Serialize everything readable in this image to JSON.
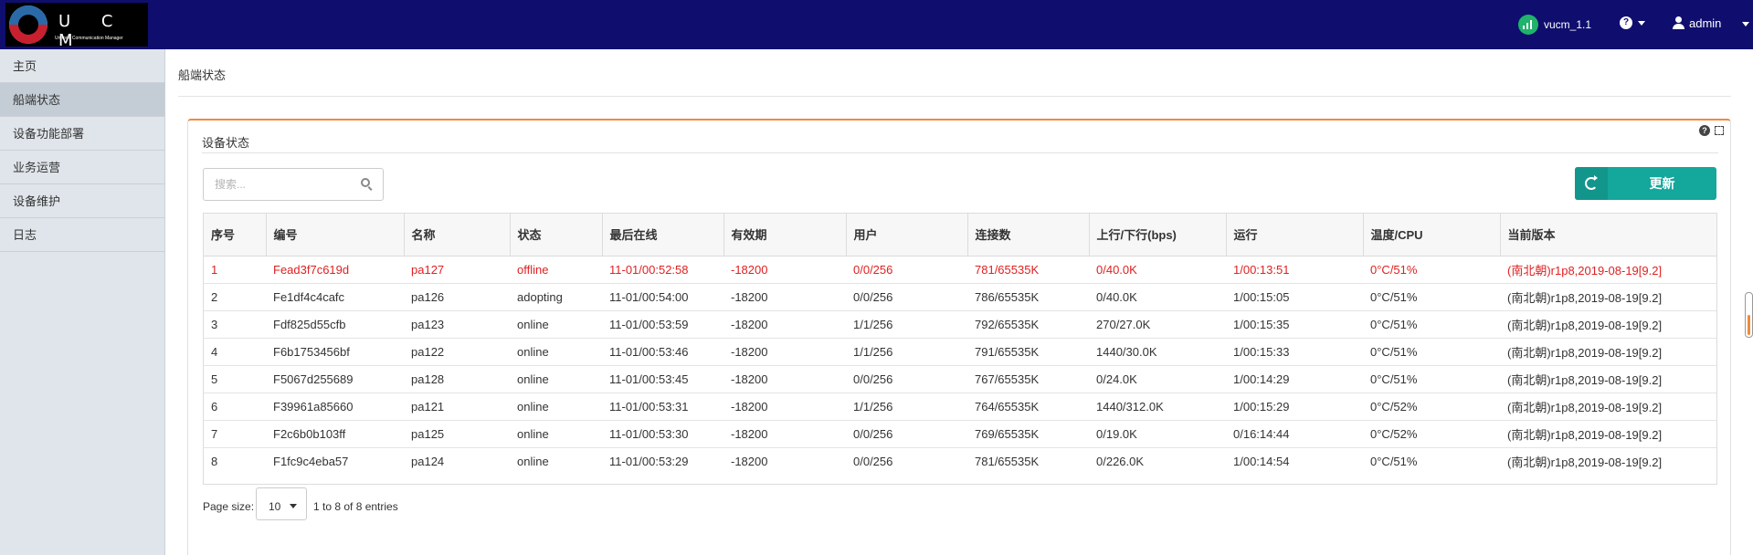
{
  "header": {
    "logo_text": "U C M",
    "logo_subtitle": "Uniform Communication Manager",
    "network_label": "vucm_1.1",
    "help_symbol": "?",
    "user_label": "admin",
    "bg_color": "#0f0e6e"
  },
  "sidebar": {
    "items": [
      {
        "label": "主页"
      },
      {
        "label": "船端状态"
      },
      {
        "label": "设备功能部署"
      },
      {
        "label": "业务运营"
      },
      {
        "label": "设备维护"
      },
      {
        "label": "日志"
      }
    ],
    "active_index": 1
  },
  "main": {
    "page_title": "船端状态",
    "panel_title": "设备状态",
    "search_placeholder": "搜索...",
    "refresh_label": "更新",
    "accent_color": "#f08a3a",
    "button_color": "#14a79c"
  },
  "table": {
    "columns": [
      "序号",
      "编号",
      "名称",
      "状态",
      "最后在线",
      "有效期",
      "用户",
      "连接数",
      "上行/下行(bps)",
      "运行",
      "温度/CPU",
      "当前版本"
    ],
    "rows": [
      [
        "1",
        "Fead3f7c619d",
        "pa127",
        "offline",
        "11-01/00:52:58",
        "-18200",
        "0/0/256",
        "781/65535K",
        "0/40.0K",
        "1/00:13:51",
        "0°C/51%",
        "(南北朝)r1p8,2019-08-19[9.2]"
      ],
      [
        "2",
        "Fe1df4c4cafc",
        "pa126",
        "adopting",
        "11-01/00:54:00",
        "-18200",
        "0/0/256",
        "786/65535K",
        "0/40.0K",
        "1/00:15:05",
        "0°C/51%",
        "(南北朝)r1p8,2019-08-19[9.2]"
      ],
      [
        "3",
        "Fdf825d55cfb",
        "pa123",
        "online",
        "11-01/00:53:59",
        "-18200",
        "1/1/256",
        "792/65535K",
        "270/27.0K",
        "1/00:15:35",
        "0°C/51%",
        "(南北朝)r1p8,2019-08-19[9.2]"
      ],
      [
        "4",
        "F6b1753456bf",
        "pa122",
        "online",
        "11-01/00:53:46",
        "-18200",
        "1/1/256",
        "791/65535K",
        "1440/30.0K",
        "1/00:15:33",
        "0°C/51%",
        "(南北朝)r1p8,2019-08-19[9.2]"
      ],
      [
        "5",
        "F5067d255689",
        "pa128",
        "online",
        "11-01/00:53:45",
        "-18200",
        "0/0/256",
        "767/65535K",
        "0/24.0K",
        "1/00:14:29",
        "0°C/51%",
        "(南北朝)r1p8,2019-08-19[9.2]"
      ],
      [
        "6",
        "F39961a85660",
        "pa121",
        "online",
        "11-01/00:53:31",
        "-18200",
        "1/1/256",
        "764/65535K",
        "1440/312.0K",
        "1/00:15:29",
        "0°C/52%",
        "(南北朝)r1p8,2019-08-19[9.2]"
      ],
      [
        "7",
        "F2c6b0b103ff",
        "pa125",
        "online",
        "11-01/00:53:30",
        "-18200",
        "0/0/256",
        "769/65535K",
        "0/19.0K",
        "0/16:14:44",
        "0°C/52%",
        "(南北朝)r1p8,2019-08-19[9.2]"
      ],
      [
        "8",
        "F1fc9c4eba57",
        "pa124",
        "online",
        "11-01/00:53:29",
        "-18200",
        "0/0/256",
        "781/65535K",
        "0/226.0K",
        "1/00:14:54",
        "0°C/51%",
        "(南北朝)r1p8,2019-08-19[9.2]"
      ]
    ],
    "offline_color": "#e02020"
  },
  "pager": {
    "page_size_label": "Page size:",
    "page_size_value": "10",
    "entries_info": "1 to 8 of 8 entries"
  }
}
